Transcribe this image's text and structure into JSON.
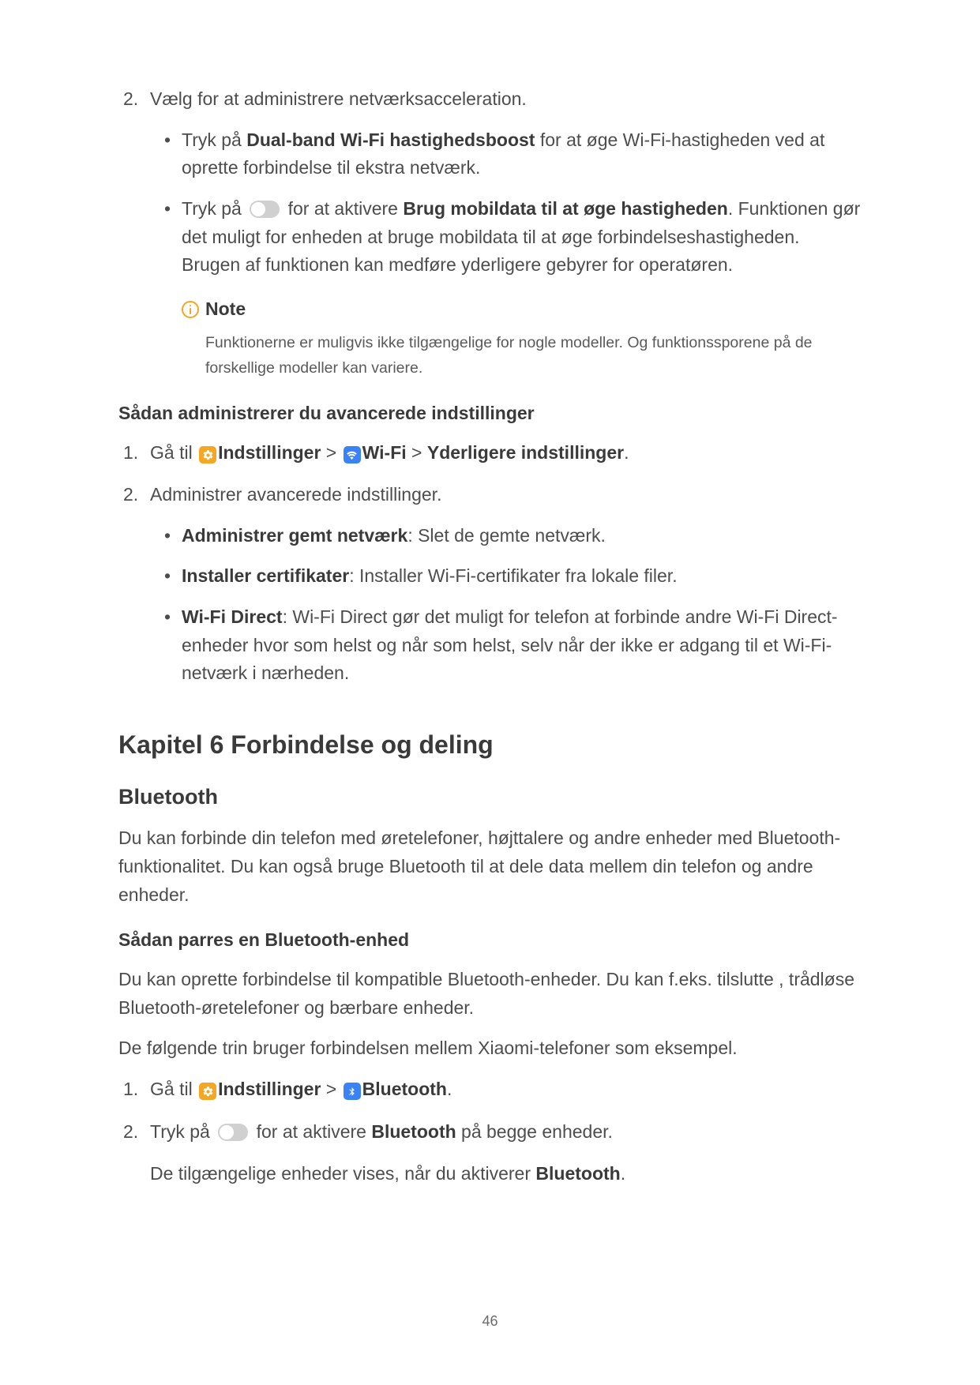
{
  "step2": {
    "marker": "2.",
    "text": "Vælg for at administrere netværksacceleration.",
    "bullets": {
      "b1": {
        "pre": "Tryk på ",
        "bold": "Dual-band Wi-Fi hastighedsboost",
        "post": " for at øge Wi-Fi-hastigheden ved at oprette forbindelse til ekstra netværk."
      },
      "b2": {
        "pre": "Tryk på ",
        "mid": " for at aktivere ",
        "bold": "Brug mobildata til at øge hastigheden",
        "post": ". Funktionen gør det muligt for enheden at bruge mobildata til at øge forbindelseshastigheden. Brugen af funktionen kan medføre yderligere gebyrer for operatøren."
      }
    },
    "note": {
      "label": "Note",
      "body": "Funktionerne er muligvis ikke tilgængelige for nogle modeller. Og funktionssporene på de forskellige modeller kan variere."
    }
  },
  "adv": {
    "heading": "Sådan administrerer du avancerede indstillinger",
    "s1": {
      "marker": "1.",
      "pre": "Gå til ",
      "settings": "Indstillinger",
      "wifi": "Wi-Fi",
      "last": "Yderligere indstillinger",
      "sep": " > ",
      "dot": "."
    },
    "s2": {
      "marker": "2.",
      "text": "Administrer avancerede indstillinger.",
      "bullets": {
        "b1": {
          "bold": "Administrer gemt netværk",
          "post": ": Slet de gemte netværk."
        },
        "b2": {
          "bold": "Installer certifikater",
          "post": ": Installer Wi-Fi-certifikater fra lokale filer."
        },
        "b3": {
          "bold": "Wi-Fi Direct",
          "post": ": Wi-Fi Direct gør det muligt for telefon at forbinde andre Wi-Fi Direct-enheder hvor som helst og når som helst, selv når der ikke er adgang til et Wi-Fi-netværk i nærheden."
        }
      }
    }
  },
  "chapter": {
    "title": "Kapitel 6 Forbindelse og deling",
    "bt": {
      "heading": "Bluetooth",
      "intro": "Du kan forbinde din telefon med øretelefoner, højttalere og andre enheder med Bluetooth-funktionalitet. Du kan også bruge Bluetooth til at dele data mellem din telefon og andre enheder.",
      "pair_heading": "Sådan parres en Bluetooth-enhed",
      "p1": "Du kan oprette forbindelse til kompatible Bluetooth-enheder. Du kan f.eks. tilslutte , trådløse Bluetooth-øretelefoner og bærbare enheder.",
      "p2": "De følgende trin bruger forbindelsen mellem Xiaomi-telefoner som eksempel.",
      "s1": {
        "marker": "1.",
        "pre": "Gå til ",
        "settings": "Indstillinger",
        "bt": "Bluetooth",
        "sep": " > ",
        "dot": "."
      },
      "s2": {
        "marker": "2.",
        "pre": "Tryk på ",
        "mid": " for at aktivere ",
        "bold": "Bluetooth",
        "post": " på begge enheder.",
        "after_pre": "De tilgængelige enheder vises, når du aktiverer ",
        "after_bold": "Bluetooth",
        "after_post": "."
      }
    }
  },
  "page_number": "46"
}
